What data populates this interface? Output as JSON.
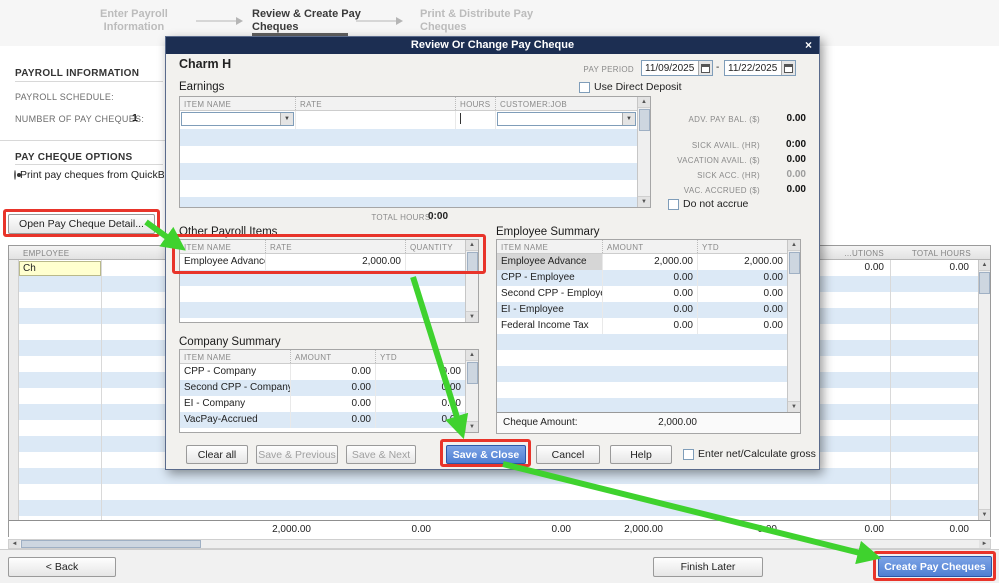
{
  "icons": {
    "close": "×",
    "chevron_down": "▼",
    "scroll_up": "▲",
    "scroll_down": "▼",
    "scroll_left": "◄",
    "scroll_right": "►"
  },
  "colors": {
    "annotation_red": "#e8342a",
    "annotation_green": "#3fd22e",
    "titlebar_navy": "#1c2e52",
    "stripe_blue": "#dce9f6",
    "highlight_yellow": "#ffffcf"
  },
  "workflow": {
    "steps": [
      {
        "line1": "Enter Payroll",
        "line2": "Information"
      },
      {
        "line1": "Review & Create Pay",
        "line2": "Cheques"
      },
      {
        "line1": "Print & Distribute Pay",
        "line2": "Cheques"
      }
    ]
  },
  "sidebar": {
    "payroll_information_title": "PAYROLL INFORMATION",
    "payroll_schedule_label": "PAYROLL SCHEDULE:",
    "num_pay_cheques_label": "NUMBER OF PAY CHEQUES:",
    "num_pay_cheques_value": "1",
    "pay_cheque_options_title": "PAY CHEQUE OPTIONS",
    "print_option": "Print pay cheques from QuickBoo",
    "open_detail_button": "Open Pay Cheque Detail..."
  },
  "employee_table": {
    "headers": {
      "employee": "EMPLOYEE",
      "contributions": "...UTIONS",
      "total_hours": "TOTAL HOURS"
    },
    "row1": {
      "employee": "Ch",
      "contributions": "0.00",
      "total_hours": "0.00"
    },
    "totals": [
      "2,000.00",
      "0.00",
      "0.00",
      "2,000.00",
      "0.00",
      "0.00",
      "0.00"
    ]
  },
  "footer": {
    "back": "< Back",
    "finish_later": "Finish Later",
    "create_pay_cheques": "Create Pay Cheques"
  },
  "dialog": {
    "title": "Review Or Change Pay Cheque",
    "employee_name": "Charm H",
    "pay_period": {
      "label": "PAY PERIOD",
      "start": "11/09/2025",
      "separator": "-",
      "end": "11/22/2025"
    },
    "direct_deposit": "Use Direct Deposit",
    "earnings": {
      "title": "Earnings",
      "headers": [
        "ITEM NAME",
        "RATE",
        "HOURS",
        "CUSTOMER:JOB"
      ],
      "total_hours_label": "TOTAL HOURS:",
      "total_hours_value": "0:00"
    },
    "balances": {
      "rows": [
        {
          "label": "ADV. PAY BAL. ($)",
          "value": "0.00"
        },
        {
          "label": "SICK AVAIL. (HR)",
          "value": "0:00"
        },
        {
          "label": "VACATION AVAIL. ($)",
          "value": "0.00"
        },
        {
          "label": "SICK ACC. (HR)",
          "value": "0.00"
        },
        {
          "label": "VAC. ACCRUED ($)",
          "value": "0.00"
        }
      ],
      "do_not_accrue": "Do not accrue"
    },
    "other_payroll_items": {
      "title": "Other Payroll Items",
      "headers": [
        "ITEM NAME",
        "RATE",
        "QUANTITY"
      ],
      "rows": [
        {
          "name": "Employee Advance",
          "rate": "2,000.00",
          "quantity": ""
        }
      ]
    },
    "company_summary": {
      "title": "Company Summary",
      "headers": [
        "ITEM NAME",
        "AMOUNT",
        "YTD"
      ],
      "rows": [
        {
          "name": "CPP - Company",
          "amount": "0.00",
          "ytd": "0.00"
        },
        {
          "name": "Second CPP - Company",
          "amount": "0.00",
          "ytd": "0.00"
        },
        {
          "name": "EI - Company",
          "amount": "0.00",
          "ytd": "0.00"
        },
        {
          "name": "VacPay-Accrued",
          "amount": "0.00",
          "ytd": "0.00"
        }
      ]
    },
    "employee_summary": {
      "title": "Employee Summary",
      "headers": [
        "ITEM NAME",
        "AMOUNT",
        "YTD"
      ],
      "rows": [
        {
          "name": "Employee Advance",
          "amount": "2,000.00",
          "ytd": "2,000.00"
        },
        {
          "name": "CPP - Employee",
          "amount": "0.00",
          "ytd": "0.00"
        },
        {
          "name": "Second CPP - Employee",
          "amount": "0.00",
          "ytd": "0.00"
        },
        {
          "name": "EI - Employee",
          "amount": "0.00",
          "ytd": "0.00"
        },
        {
          "name": "Federal Income Tax",
          "amount": "0.00",
          "ytd": "0.00"
        }
      ],
      "cheque_amount_label": "Cheque Amount:",
      "cheque_amount_value": "2,000.00"
    },
    "buttons": {
      "clear_all": "Clear all",
      "save_previous": "Save & Previous",
      "save_next": "Save & Next",
      "save_close": "Save & Close",
      "cancel": "Cancel",
      "help": "Help",
      "enter_net": "Enter net/Calculate gross"
    }
  }
}
